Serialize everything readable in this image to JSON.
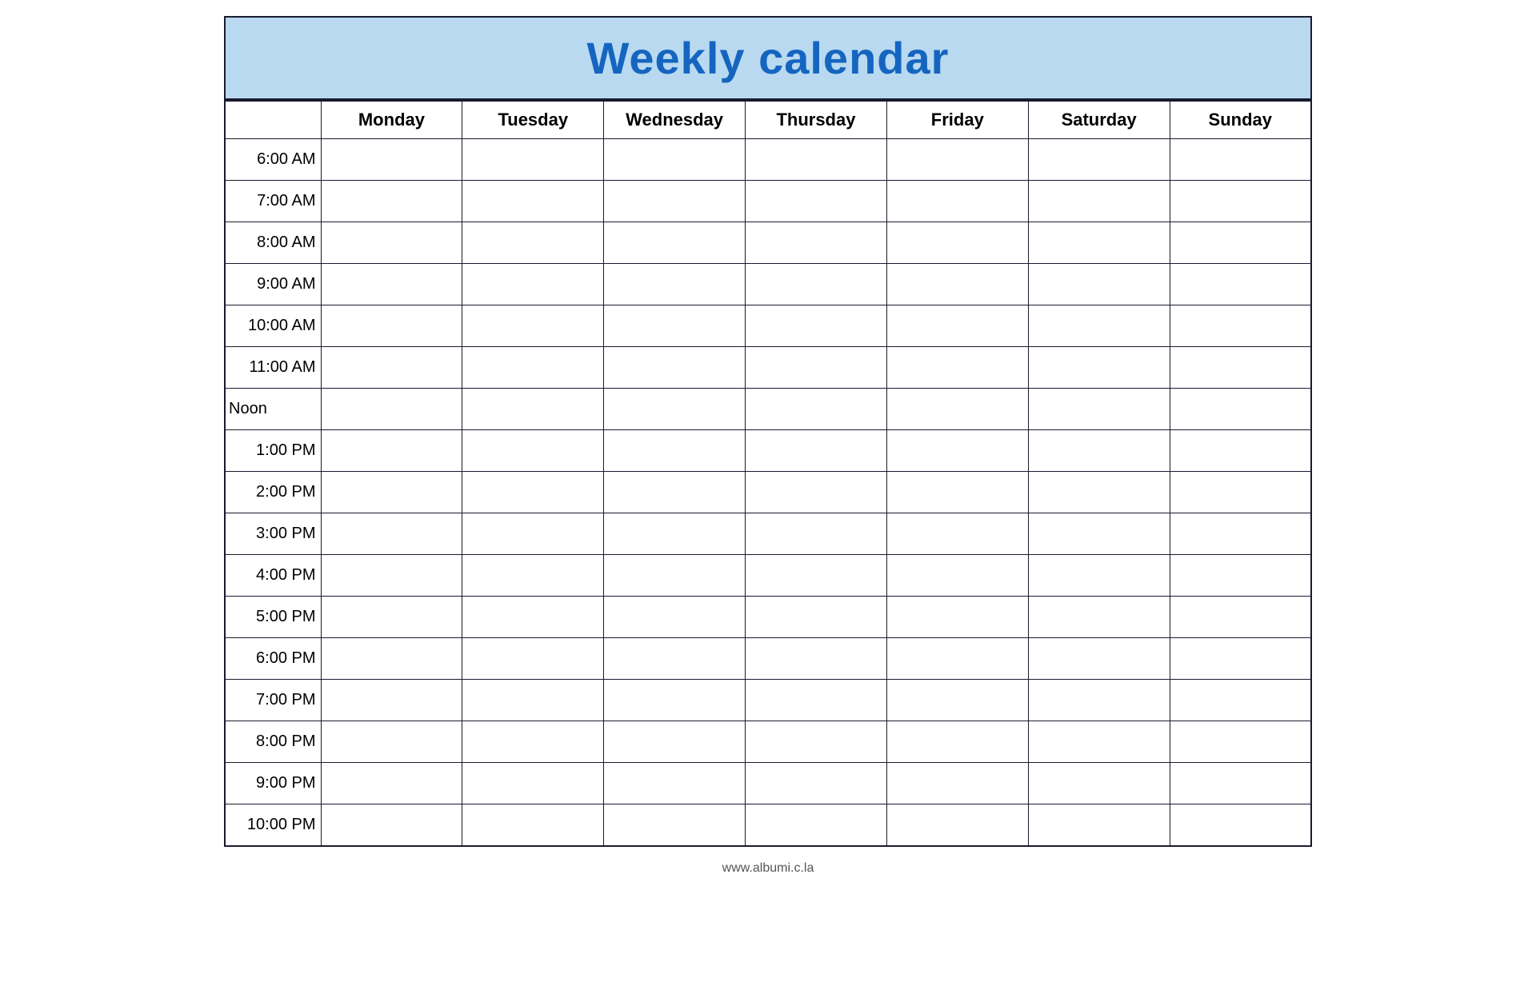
{
  "header": {
    "title": "Weekly calendar",
    "background_color": "#b8d9f0",
    "title_color": "#1565c0"
  },
  "columns": {
    "time_header": "",
    "days": [
      "Monday",
      "Tuesday",
      "Wednesday",
      "Thursday",
      "Friday",
      "Saturday",
      "Sunday"
    ]
  },
  "time_slots": [
    "6:00 AM",
    "7:00 AM",
    "8:00 AM",
    "9:00 AM",
    "10:00 AM",
    "11:00 AM",
    "Noon",
    "1:00 PM",
    "2:00 PM",
    "3:00 PM",
    "4:00 PM",
    "5:00 PM",
    "6:00 PM",
    "7:00 PM",
    "8:00 PM",
    "9:00 PM",
    "10:00 PM"
  ],
  "footer": {
    "url": "www.albumi.c.la"
  }
}
